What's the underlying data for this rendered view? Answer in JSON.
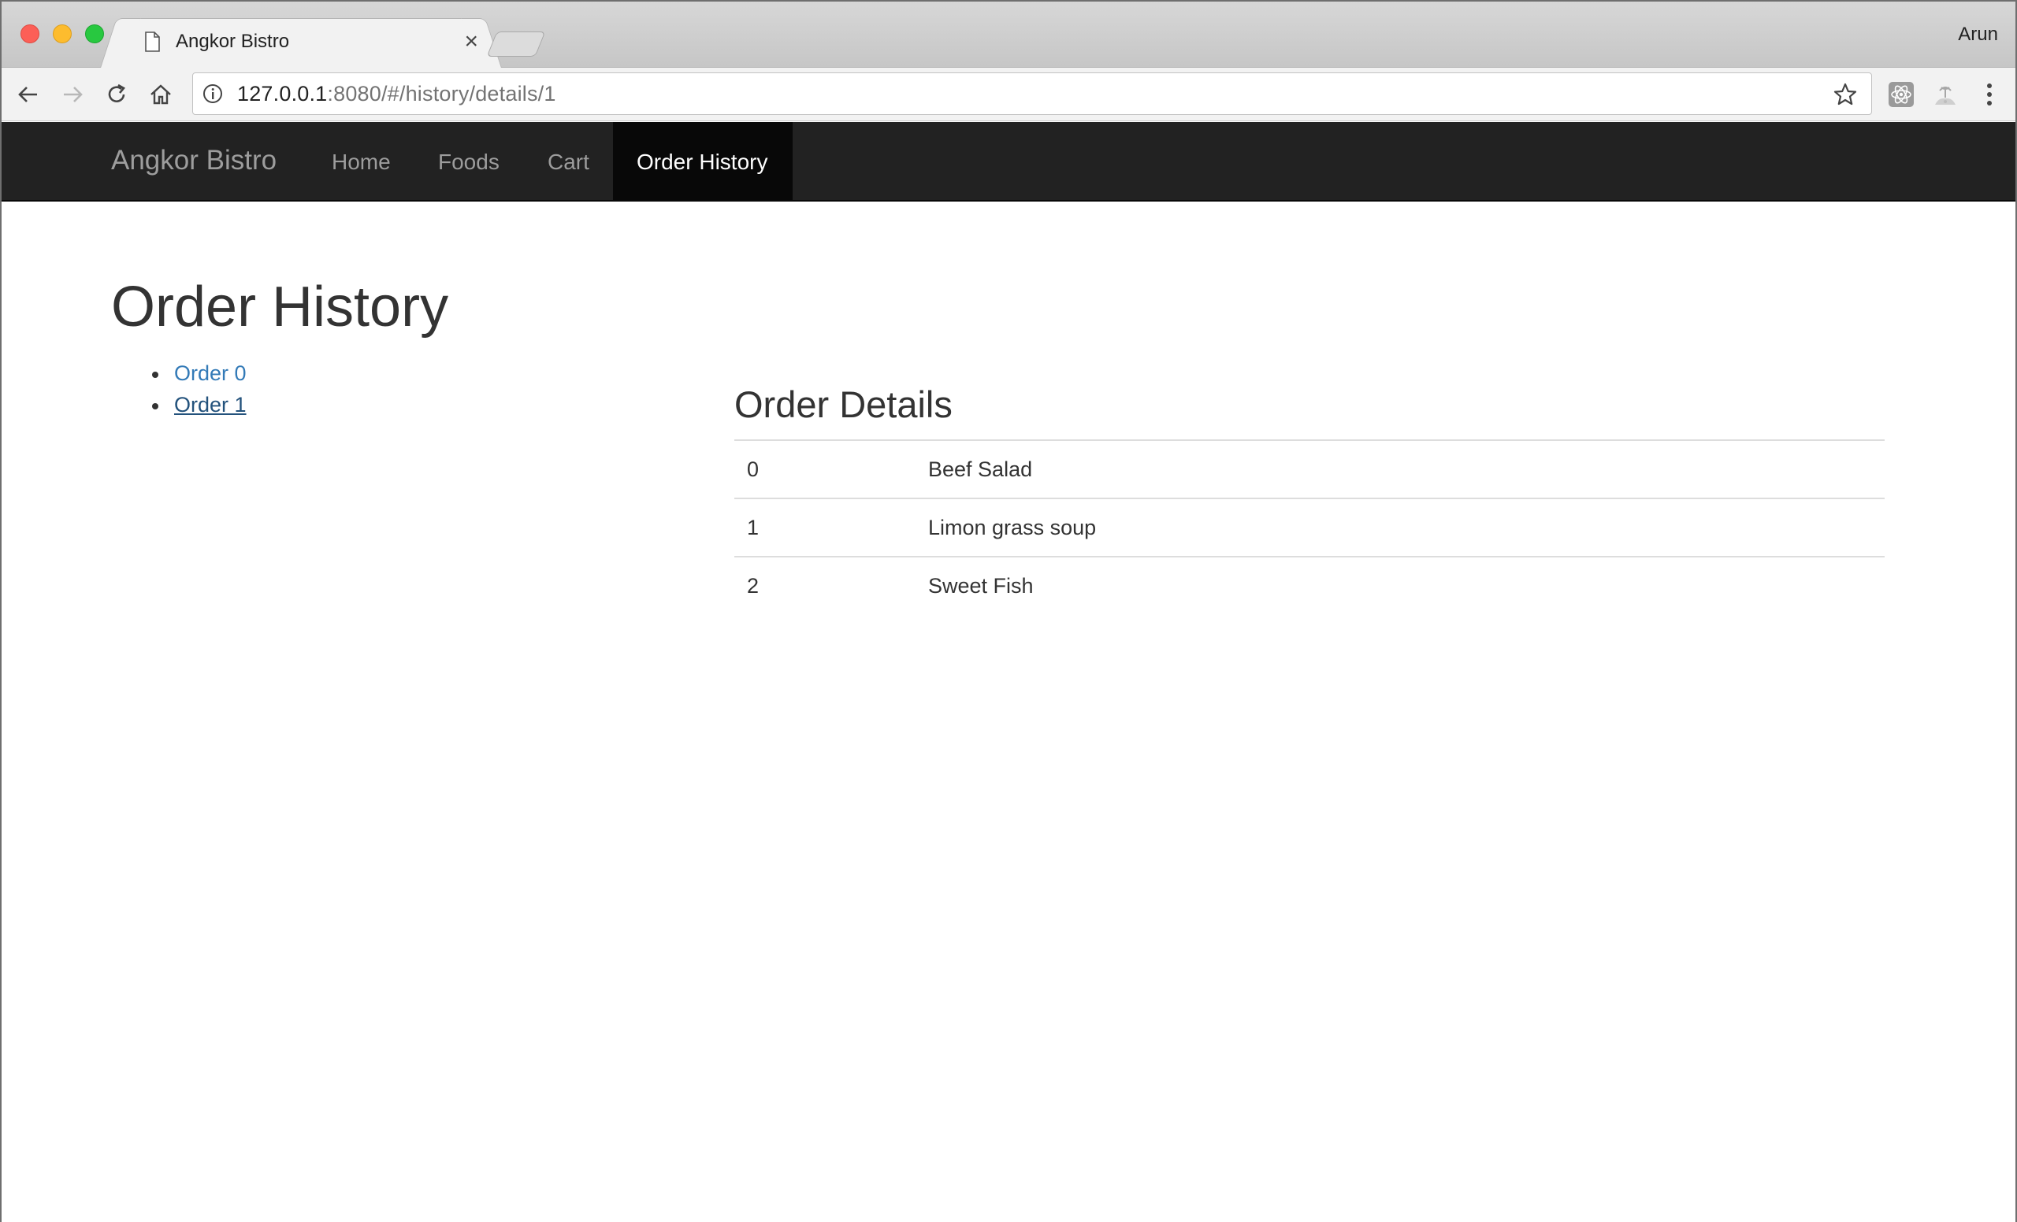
{
  "browser": {
    "tab_title": "Angkor Bistro",
    "tab_close": "×",
    "profile_name": "Arun",
    "url_host": "127.0.0.1",
    "url_rest": ":8080/#/history/details/1"
  },
  "navbar": {
    "brand": "Angkor Bistro",
    "links": [
      {
        "label": "Home"
      },
      {
        "label": "Foods"
      },
      {
        "label": "Cart"
      },
      {
        "label": "Order History",
        "active": true
      }
    ]
  },
  "history": {
    "title": "Order History",
    "orders": [
      {
        "label": "Order 0"
      },
      {
        "label": "Order 1",
        "selected": true
      }
    ]
  },
  "details": {
    "title": "Order Details",
    "rows": [
      {
        "index": "0",
        "name": "Beef Salad"
      },
      {
        "index": "1",
        "name": "Limon grass soup"
      },
      {
        "index": "2",
        "name": "Sweet Fish"
      }
    ]
  },
  "colors": {
    "navbar_bg": "#222222",
    "navbar_active_bg": "#080808",
    "link": "#337ab7",
    "link_visited": "#23527c"
  }
}
